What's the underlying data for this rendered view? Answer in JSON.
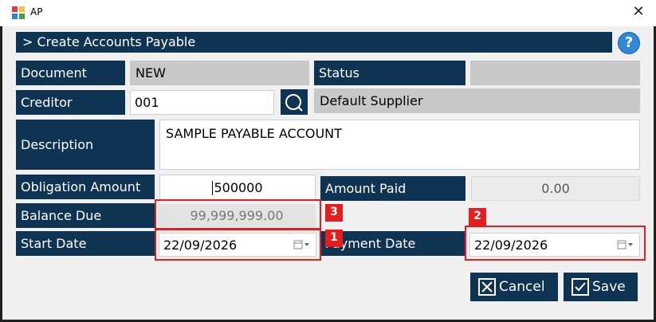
{
  "window": {
    "title": "AP",
    "close_glyph": "✕"
  },
  "header": {
    "title": "> Create Accounts Payable",
    "help_glyph": "?"
  },
  "form": {
    "document_label": "Document",
    "document_value": "NEW",
    "status_label": "Status",
    "status_value": "",
    "creditor_label": "Creditor",
    "creditor_value": "001",
    "creditor_name": "Default Supplier",
    "description_label": "Description",
    "description_value": "SAMPLE PAYABLE ACCOUNT",
    "obligation_label": "Obligation Amount",
    "obligation_value": "500000",
    "amount_paid_label": "Amount Paid",
    "amount_paid_value": "0.00",
    "balance_label": "Balance Due",
    "balance_value": "99,999,999.00",
    "start_date_label": "Start Date",
    "start_date_value": "22/09/2026",
    "payment_date_label": "Payment Date",
    "payment_date_value": "22/09/2026"
  },
  "annotations": {
    "badge_1": "1",
    "badge_2": "2",
    "badge_3": "3"
  },
  "buttons": {
    "cancel_label": "Cancel",
    "save_label": "Save"
  },
  "icons": {
    "app": "app-logo-icon",
    "search": "search-icon",
    "calendar": "calendar-dropdown-icon",
    "cancel": "x-box-icon",
    "save": "checkmark-box-icon"
  },
  "colors": {
    "label_bg": "#0f3352",
    "readonly_bg": "#c8c8c8",
    "highlight": "#e51d1d",
    "help": "#2f89d8"
  }
}
